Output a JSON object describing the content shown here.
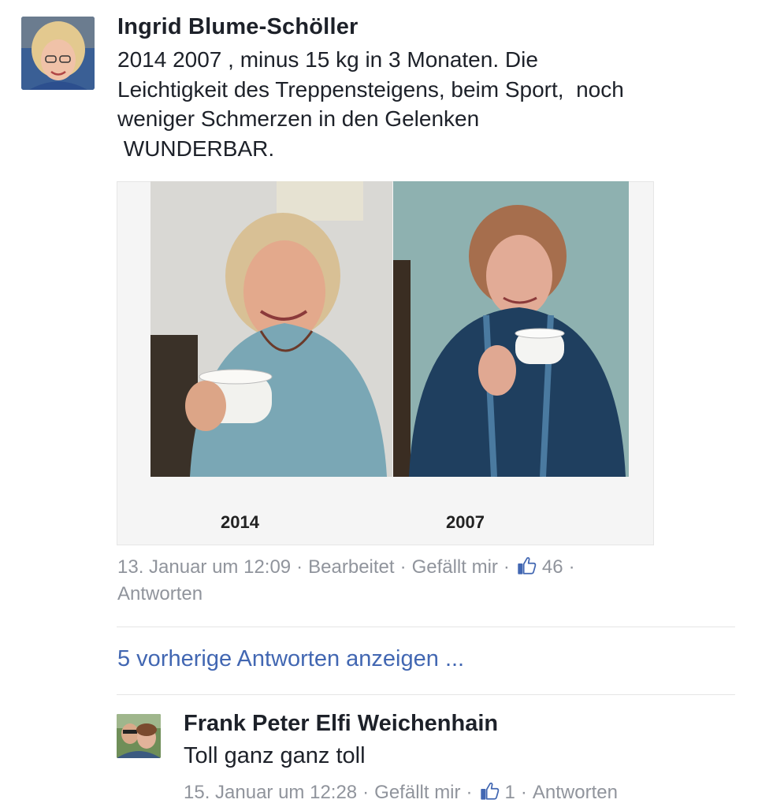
{
  "comment": {
    "author": "Ingrid Blume-Schöller",
    "text_lines": [
      "2014 2007 , minus 15 kg in 3 Monaten. Die",
      "Leichtigkeit des Treppensteigens, beim Sport,  noch",
      "weniger Schmerzen in den Gelenken",
      " WUNDERBAR."
    ],
    "photo": {
      "caption_left": "2014",
      "caption_right": "2007"
    },
    "meta": {
      "date": "13. Januar um 12:09",
      "edited": "Bearbeitet",
      "like": "Gefällt mir",
      "likes_count": "46",
      "reply": "Antworten"
    }
  },
  "more_replies": "5 vorherige Antworten anzeigen ...",
  "reply": {
    "author": "Frank Peter Elfi Weichenhain",
    "text": "Toll ganz ganz toll",
    "meta": {
      "date": "15. Januar um 12:28",
      "like": "Gefällt mir",
      "likes_count": "1",
      "reply": "Antworten"
    }
  },
  "colors": {
    "link": "#4267b2",
    "meta": "#90949c",
    "text": "#1d2129"
  },
  "icons": [
    "thumbs-up-icon"
  ]
}
